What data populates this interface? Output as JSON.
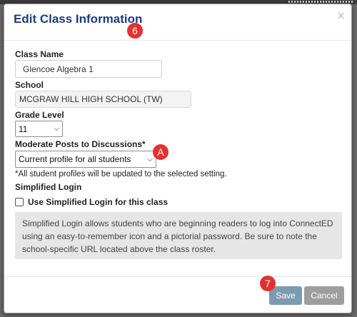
{
  "dialog": {
    "title": "Edit Class Information",
    "close_glyph": "×"
  },
  "form": {
    "class_name_label": "Class Name",
    "class_name_value": "Glencoe Algebra 1",
    "school_label": "School",
    "school_value": "MCGRAW HILL HIGH SCHOOL (TW)",
    "grade_label": "Grade Level",
    "grade_value": "11",
    "moderate_label": "Moderate Posts to Discussions*",
    "moderate_value": "Current profile for all students",
    "moderate_note": "*All student profiles will be updated to the selected setting.",
    "simplified_label": "Simplified Login",
    "simplified_checkbox_label": "Use Simplified Login for this class",
    "simplified_checked": false,
    "info_text": "Simplified Login allows students who are beginning readers to log into ConnectED using an easy-to-remember icon and a pictorial password. Be sure to note the school-specific URL located above the class roster."
  },
  "footer": {
    "save_label": "Save",
    "cancel_label": "Cancel"
  },
  "callouts": {
    "step6": "6",
    "stepA": "A",
    "step7": "7"
  },
  "colors": {
    "title": "#1d3d7e",
    "save": "#7d9bb0",
    "cancel": "#9e9e9e",
    "callout": "#e53030"
  },
  "icons": {
    "close": "close-icon",
    "select_caret": "chevron-down-icon",
    "checkbox": "checkbox-icon"
  }
}
